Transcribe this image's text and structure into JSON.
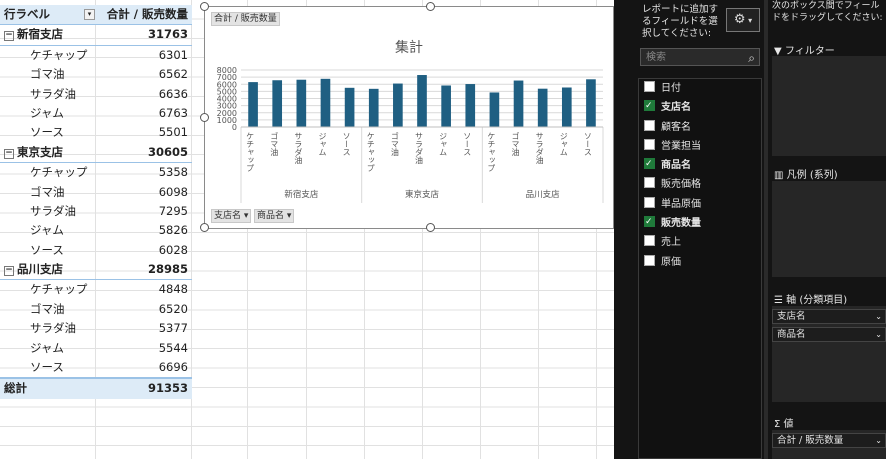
{
  "pivot": {
    "header_label": "行ラベル",
    "header_value": "合計 / 販売数量",
    "groups": [
      {
        "name": "新宿支店",
        "total": "31763",
        "items": [
          {
            "label": "ケチャップ",
            "value": "6301"
          },
          {
            "label": "ゴマ油",
            "value": "6562"
          },
          {
            "label": "サラダ油",
            "value": "6636"
          },
          {
            "label": "ジャム",
            "value": "6763"
          },
          {
            "label": "ソース",
            "value": "5501"
          }
        ]
      },
      {
        "name": "東京支店",
        "total": "30605",
        "items": [
          {
            "label": "ケチャップ",
            "value": "5358"
          },
          {
            "label": "ゴマ油",
            "value": "6098"
          },
          {
            "label": "サラダ油",
            "value": "7295"
          },
          {
            "label": "ジャム",
            "value": "5826"
          },
          {
            "label": "ソース",
            "value": "6028"
          }
        ]
      },
      {
        "name": "品川支店",
        "total": "28985",
        "items": [
          {
            "label": "ケチャップ",
            "value": "4848"
          },
          {
            "label": "ゴマ油",
            "value": "6520"
          },
          {
            "label": "サラダ油",
            "value": "5377"
          },
          {
            "label": "ジャム",
            "value": "5544"
          },
          {
            "label": "ソース",
            "value": "6696"
          }
        ]
      }
    ],
    "grand_total_label": "総計",
    "grand_total_value": "91353"
  },
  "chart": {
    "value_field_button": "合計 / 販売数量",
    "axis_field_buttons": [
      "支店名",
      "商品名"
    ],
    "bar_color": "#1f5f82"
  },
  "chart_data": {
    "type": "bar",
    "title": "集計",
    "groups": [
      "新宿支店",
      "東京支店",
      "品川支店"
    ],
    "categories": [
      "ケチャップ",
      "ゴマ油",
      "サラダ油",
      "ジャム",
      "ソース"
    ],
    "series": [
      {
        "values": [
          6301,
          6562,
          6636,
          6763,
          5501,
          5358,
          6098,
          7295,
          5826,
          6028,
          4848,
          6520,
          5377,
          5544,
          6696
        ]
      }
    ],
    "yticks": [
      "8000",
      "7000",
      "6000",
      "5000",
      "4000",
      "3000",
      "2000",
      "1000",
      "0"
    ],
    "ylim": [
      0,
      8000
    ],
    "grid": true
  },
  "field_pane": {
    "instruction": "レポートに追加するフィールドを選択してください:",
    "settings_icon": "gear-icon",
    "search_placeholder": "検索",
    "fields": [
      {
        "label": "日付",
        "checked": false
      },
      {
        "label": "支店名",
        "checked": true
      },
      {
        "label": "顧客名",
        "checked": false
      },
      {
        "label": "営業担当",
        "checked": false
      },
      {
        "label": "商品名",
        "checked": true
      },
      {
        "label": "販売価格",
        "checked": false
      },
      {
        "label": "単品原価",
        "checked": false
      },
      {
        "label": "販売数量",
        "checked": true
      },
      {
        "label": "売上",
        "checked": false
      },
      {
        "label": "原価",
        "checked": false
      }
    ]
  },
  "areas_pane": {
    "instruction": "次のボックス間でフィールドをドラッグしてください:",
    "filters_label": "フィルター",
    "legend_label": "凡例 (系列)",
    "axis_label": "軸 (分類項目)",
    "axis_fields": [
      "支店名",
      "商品名"
    ],
    "values_label": "値",
    "values_fields": [
      "合計 / 販売数量"
    ]
  }
}
